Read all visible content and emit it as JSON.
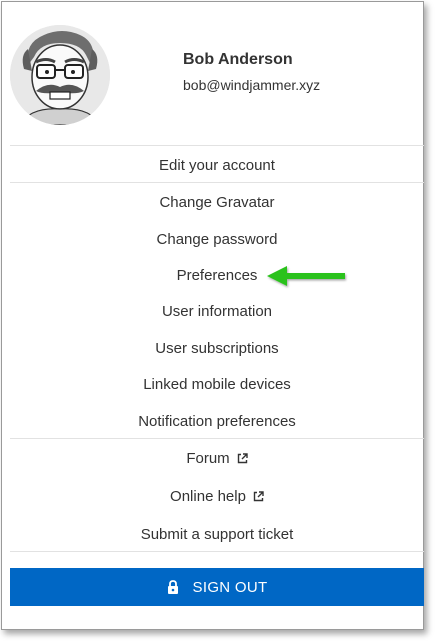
{
  "user": {
    "name": "Bob Anderson",
    "email": "bob@windjammer.xyz"
  },
  "menu": {
    "account": "Edit your account",
    "gravatar": "Change Gravatar",
    "password": "Change password",
    "preferences": "Preferences",
    "user_information": "User information",
    "subscriptions": "User subscriptions",
    "mobile_devices": "Linked mobile devices",
    "notifications": "Notification preferences",
    "forum": "Forum",
    "online_help": "Online help",
    "support_ticket": "Submit a support ticket"
  },
  "signout": {
    "label": "SIGN OUT"
  },
  "icons": {
    "external": "external-link-icon",
    "lock": "lock-icon",
    "pointer": "green-arrow-icon"
  },
  "colors": {
    "accent": "#0067c5",
    "arrow": "#2bc21b"
  }
}
